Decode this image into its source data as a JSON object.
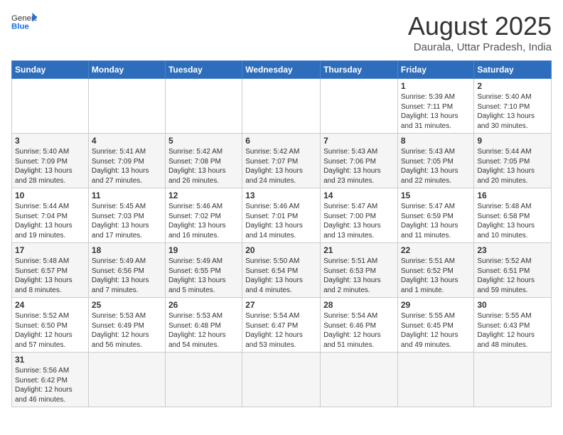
{
  "logo": {
    "text_general": "General",
    "text_blue": "Blue"
  },
  "title": "August 2025",
  "subtitle": "Daurala, Uttar Pradesh, India",
  "weekdays": [
    "Sunday",
    "Monday",
    "Tuesday",
    "Wednesday",
    "Thursday",
    "Friday",
    "Saturday"
  ],
  "weeks": [
    [
      {
        "day": "",
        "info": ""
      },
      {
        "day": "",
        "info": ""
      },
      {
        "day": "",
        "info": ""
      },
      {
        "day": "",
        "info": ""
      },
      {
        "day": "",
        "info": ""
      },
      {
        "day": "1",
        "info": "Sunrise: 5:39 AM\nSunset: 7:11 PM\nDaylight: 13 hours\nand 31 minutes."
      },
      {
        "day": "2",
        "info": "Sunrise: 5:40 AM\nSunset: 7:10 PM\nDaylight: 13 hours\nand 30 minutes."
      }
    ],
    [
      {
        "day": "3",
        "info": "Sunrise: 5:40 AM\nSunset: 7:09 PM\nDaylight: 13 hours\nand 28 minutes."
      },
      {
        "day": "4",
        "info": "Sunrise: 5:41 AM\nSunset: 7:09 PM\nDaylight: 13 hours\nand 27 minutes."
      },
      {
        "day": "5",
        "info": "Sunrise: 5:42 AM\nSunset: 7:08 PM\nDaylight: 13 hours\nand 26 minutes."
      },
      {
        "day": "6",
        "info": "Sunrise: 5:42 AM\nSunset: 7:07 PM\nDaylight: 13 hours\nand 24 minutes."
      },
      {
        "day": "7",
        "info": "Sunrise: 5:43 AM\nSunset: 7:06 PM\nDaylight: 13 hours\nand 23 minutes."
      },
      {
        "day": "8",
        "info": "Sunrise: 5:43 AM\nSunset: 7:05 PM\nDaylight: 13 hours\nand 22 minutes."
      },
      {
        "day": "9",
        "info": "Sunrise: 5:44 AM\nSunset: 7:05 PM\nDaylight: 13 hours\nand 20 minutes."
      }
    ],
    [
      {
        "day": "10",
        "info": "Sunrise: 5:44 AM\nSunset: 7:04 PM\nDaylight: 13 hours\nand 19 minutes."
      },
      {
        "day": "11",
        "info": "Sunrise: 5:45 AM\nSunset: 7:03 PM\nDaylight: 13 hours\nand 17 minutes."
      },
      {
        "day": "12",
        "info": "Sunrise: 5:46 AM\nSunset: 7:02 PM\nDaylight: 13 hours\nand 16 minutes."
      },
      {
        "day": "13",
        "info": "Sunrise: 5:46 AM\nSunset: 7:01 PM\nDaylight: 13 hours\nand 14 minutes."
      },
      {
        "day": "14",
        "info": "Sunrise: 5:47 AM\nSunset: 7:00 PM\nDaylight: 13 hours\nand 13 minutes."
      },
      {
        "day": "15",
        "info": "Sunrise: 5:47 AM\nSunset: 6:59 PM\nDaylight: 13 hours\nand 11 minutes."
      },
      {
        "day": "16",
        "info": "Sunrise: 5:48 AM\nSunset: 6:58 PM\nDaylight: 13 hours\nand 10 minutes."
      }
    ],
    [
      {
        "day": "17",
        "info": "Sunrise: 5:48 AM\nSunset: 6:57 PM\nDaylight: 13 hours\nand 8 minutes."
      },
      {
        "day": "18",
        "info": "Sunrise: 5:49 AM\nSunset: 6:56 PM\nDaylight: 13 hours\nand 7 minutes."
      },
      {
        "day": "19",
        "info": "Sunrise: 5:49 AM\nSunset: 6:55 PM\nDaylight: 13 hours\nand 5 minutes."
      },
      {
        "day": "20",
        "info": "Sunrise: 5:50 AM\nSunset: 6:54 PM\nDaylight: 13 hours\nand 4 minutes."
      },
      {
        "day": "21",
        "info": "Sunrise: 5:51 AM\nSunset: 6:53 PM\nDaylight: 13 hours\nand 2 minutes."
      },
      {
        "day": "22",
        "info": "Sunrise: 5:51 AM\nSunset: 6:52 PM\nDaylight: 13 hours\nand 1 minute."
      },
      {
        "day": "23",
        "info": "Sunrise: 5:52 AM\nSunset: 6:51 PM\nDaylight: 12 hours\nand 59 minutes."
      }
    ],
    [
      {
        "day": "24",
        "info": "Sunrise: 5:52 AM\nSunset: 6:50 PM\nDaylight: 12 hours\nand 57 minutes."
      },
      {
        "day": "25",
        "info": "Sunrise: 5:53 AM\nSunset: 6:49 PM\nDaylight: 12 hours\nand 56 minutes."
      },
      {
        "day": "26",
        "info": "Sunrise: 5:53 AM\nSunset: 6:48 PM\nDaylight: 12 hours\nand 54 minutes."
      },
      {
        "day": "27",
        "info": "Sunrise: 5:54 AM\nSunset: 6:47 PM\nDaylight: 12 hours\nand 53 minutes."
      },
      {
        "day": "28",
        "info": "Sunrise: 5:54 AM\nSunset: 6:46 PM\nDaylight: 12 hours\nand 51 minutes."
      },
      {
        "day": "29",
        "info": "Sunrise: 5:55 AM\nSunset: 6:45 PM\nDaylight: 12 hours\nand 49 minutes."
      },
      {
        "day": "30",
        "info": "Sunrise: 5:55 AM\nSunset: 6:43 PM\nDaylight: 12 hours\nand 48 minutes."
      }
    ],
    [
      {
        "day": "31",
        "info": "Sunrise: 5:56 AM\nSunset: 6:42 PM\nDaylight: 12 hours\nand 46 minutes."
      },
      {
        "day": "",
        "info": ""
      },
      {
        "day": "",
        "info": ""
      },
      {
        "day": "",
        "info": ""
      },
      {
        "day": "",
        "info": ""
      },
      {
        "day": "",
        "info": ""
      },
      {
        "day": "",
        "info": ""
      }
    ]
  ]
}
